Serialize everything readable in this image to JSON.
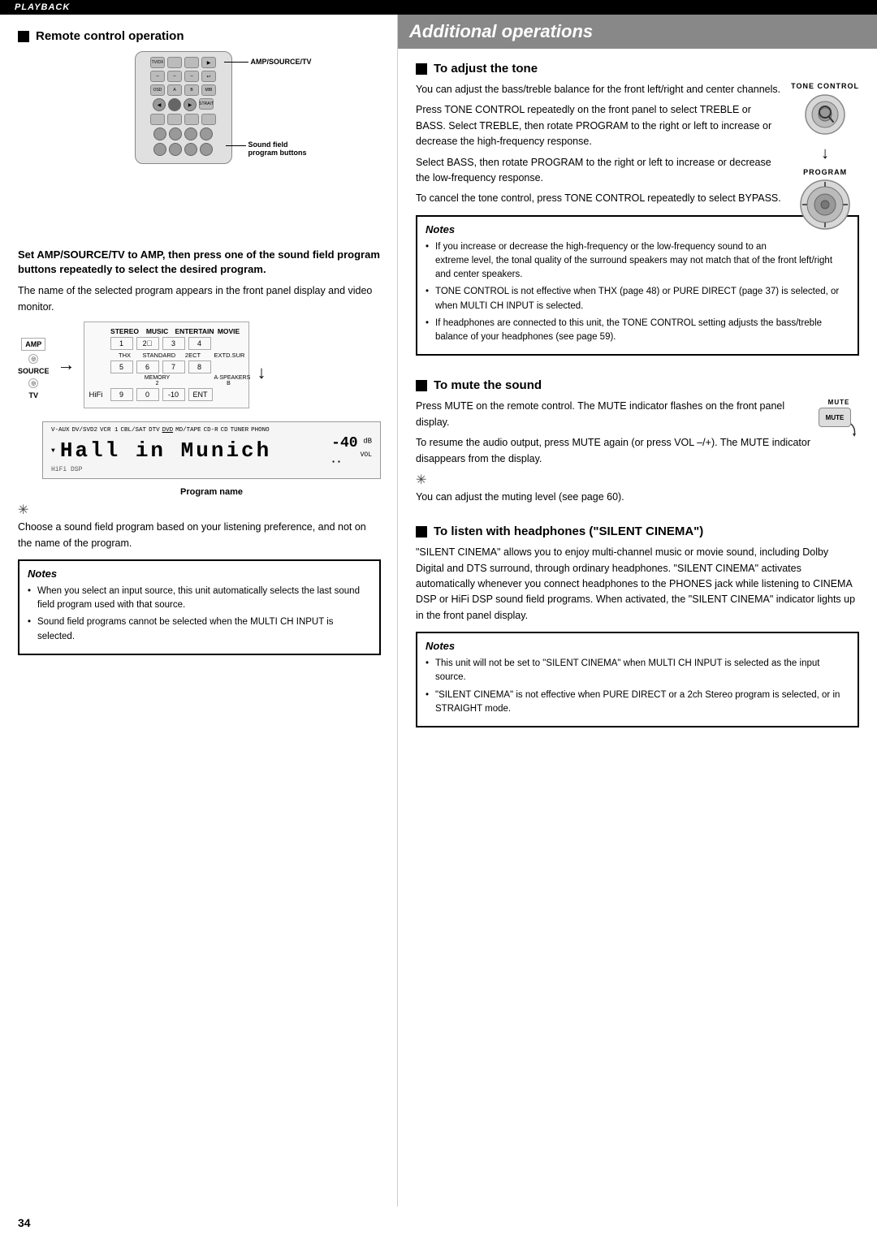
{
  "top_bar": {
    "label": "PLAYBACK"
  },
  "left_column": {
    "section_title": "Remote control operation",
    "amp_source_tv_label": "AMP/SOURCE/TV",
    "sound_field_label": "Sound field\nprogram buttons",
    "instruction_bold": "Set AMP/SOURCE/TV to AMP, then press one of the sound field program buttons repeatedly to select the desired program.",
    "instruction_body": "The name of the selected program appears in the front panel display and video monitor.",
    "program_name_label": "Program name",
    "display_main": "Hall in Munich",
    "display_volume": "-40",
    "display_vol_label": "VOL",
    "tip_text": "Choose a sound field program based on your listening preference, and not on the name of the program.",
    "notes_title": "Notes",
    "notes": [
      "When you select an input source, this unit automatically selects the last sound field program used with that source.",
      "Sound field programs cannot be selected when the MULTI CH INPUT is selected."
    ],
    "sfp_headers": [
      "STEREO",
      "MUSIC",
      "ENTERTAIN",
      "MOVIE"
    ],
    "sfp_row1": [
      "1",
      "2",
      "3",
      "4"
    ],
    "sfp_row2_labels": [
      "THX",
      "STANDARD",
      "2ECT",
      "EXTD.SUR"
    ],
    "sfp_row2": [
      "5",
      "6",
      "7",
      "8"
    ],
    "sfp_row3_labels": [
      "",
      "MEMORY 2",
      "",
      "A·SPEAKERS B"
    ],
    "sfp_row3": [
      "9",
      "0",
      "-10",
      "ENT"
    ]
  },
  "right_column": {
    "page_header": "Additional operations",
    "sections": [
      {
        "id": "tone",
        "title": "To adjust the tone",
        "body_paragraphs": [
          "You can adjust the bass/treble balance for the front left/right and center channels.",
          "Press TONE CONTROL repeatedly on the front panel to select TREBLE or BASS. Select TREBLE, then rotate PROGRAM to the right or left to increase or decrease the high-frequency response.",
          "Select BASS, then rotate PROGRAM to the right or left to increase or decrease the low-frequency response.",
          "To cancel the tone control, press TONE CONTROL repeatedly to select BYPASS."
        ],
        "tone_control_label": "TONE CONTROL",
        "program_label": "PROGRAM",
        "notes_title": "Notes",
        "notes": [
          "If you increase or decrease the high-frequency or the low-frequency sound to an extreme level, the tonal quality of the surround speakers may not match that of the front left/right and center speakers.",
          "TONE CONTROL is not effective when THX (page 48) or PURE DIRECT (page 37) is selected, or when MULTI CH INPUT is selected.",
          "If headphones are connected to this unit, the TONE CONTROL setting adjusts the bass/treble balance of your headphones (see page 59)."
        ]
      },
      {
        "id": "mute",
        "title": "To mute the sound",
        "body_paragraphs": [
          "Press MUTE on the remote control. The MUTE indicator flashes on the front panel display.",
          "To resume the audio output, press MUTE again (or press VOL –/+). The MUTE indicator disappears from the display."
        ],
        "mute_label": "MUTE",
        "tip_text": "You can adjust the muting level (see page 60)."
      },
      {
        "id": "headphones",
        "title": "To listen with headphones (\"SILENT CINEMA\")",
        "body_paragraphs": [
          "\"SILENT CINEMA\" allows you to enjoy multi-channel music or movie sound, including Dolby Digital and DTS surround, through ordinary headphones. \"SILENT CINEMA\" activates automatically whenever you connect headphones to the PHONES jack while listening to CINEMA DSP or HiFi DSP sound field programs. When activated, the \"SILENT CINEMA\" indicator lights up in the front panel display."
        ],
        "notes_title": "Notes",
        "notes": [
          "This unit will not be set to \"SILENT CINEMA\" when MULTI CH INPUT is selected as the input source.",
          "\"SILENT CINEMA\" is not effective when PURE DIRECT or a 2ch Stereo program is selected, or in STRAIGHT mode."
        ]
      }
    ]
  },
  "page_number": "34"
}
